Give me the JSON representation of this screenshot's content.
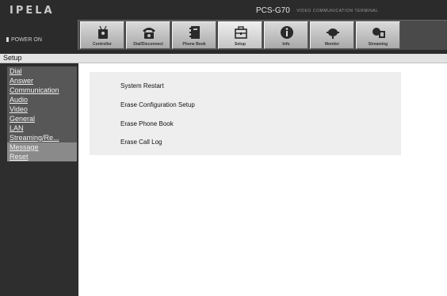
{
  "header": {
    "logo": "IPELA",
    "model": "PCS-G70",
    "model_subtitle": "VIDEO COMMUNICATION TERMINAL",
    "power_status": "POWER ON"
  },
  "toolbar": {
    "buttons": [
      {
        "label": "Controller",
        "icon": "controller-icon"
      },
      {
        "label": "Dial/Disconnect",
        "icon": "telephone-icon"
      },
      {
        "label": "Phone Book",
        "icon": "phone-book-icon"
      },
      {
        "label": "Setup",
        "icon": "toolbox-icon"
      },
      {
        "label": "Info",
        "icon": "info-icon"
      },
      {
        "label": "Monitor",
        "icon": "monitor-icon"
      },
      {
        "label": "Streaming",
        "icon": "streaming-icon"
      }
    ]
  },
  "section": {
    "title": "Setup"
  },
  "sidebar": {
    "items": [
      {
        "label": "Dial"
      },
      {
        "label": "Answer"
      },
      {
        "label": "Communication"
      },
      {
        "label": "Audio"
      },
      {
        "label": "Video"
      },
      {
        "label": "General"
      },
      {
        "label": "LAN"
      },
      {
        "label": "Streaming/Re..."
      },
      {
        "label": "Message"
      },
      {
        "label": "Reset"
      }
    ]
  },
  "main": {
    "actions": [
      {
        "label": "System Restart"
      },
      {
        "label": "Erase Configuration Setup"
      },
      {
        "label": "Erase Phone Book"
      },
      {
        "label": "Erase Call Log"
      }
    ]
  }
}
